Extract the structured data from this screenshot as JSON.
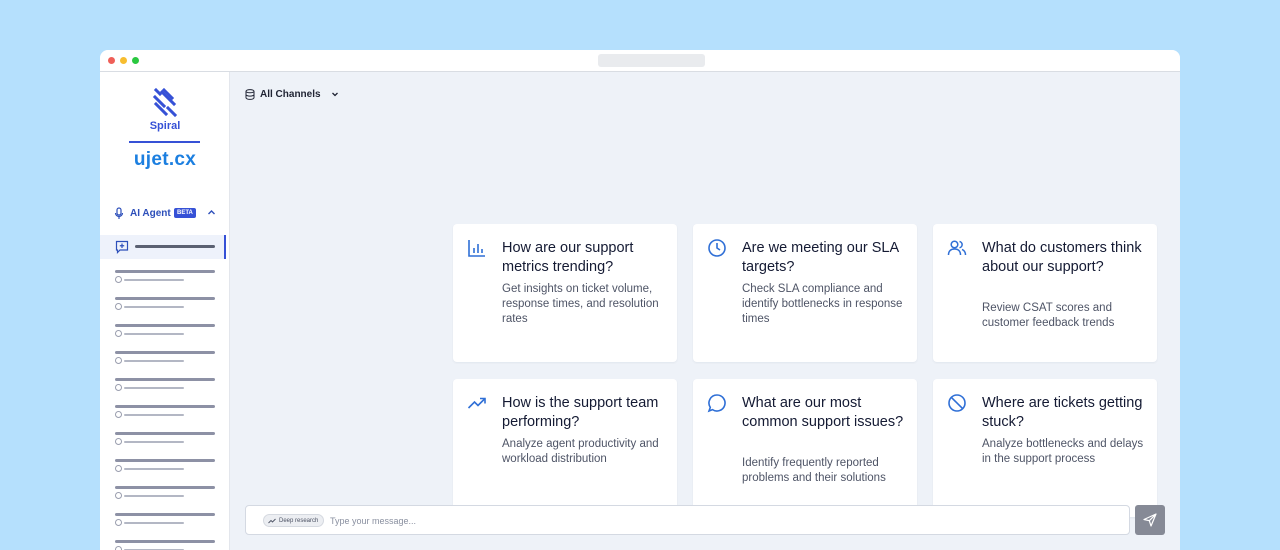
{
  "sidebar": {
    "logo_text": "Spiral",
    "brand": "ujet.cx",
    "agent_label": "AI Agent",
    "agent_badge": "BETA"
  },
  "header": {
    "channel_label": "All Channels"
  },
  "cards": [
    {
      "icon": "bar-chart-icon",
      "title": "How are our support metrics trending?",
      "desc": "Get insights on ticket volume, response times, and resolution rates"
    },
    {
      "icon": "clock-icon",
      "title": "Are we meeting our SLA targets?",
      "desc": "Check SLA compliance and identify bottlenecks in response  times"
    },
    {
      "icon": "users-icon",
      "title": "What do customers think about our support?",
      "desc": "Review CSAT scores and customer feedback trends"
    },
    {
      "icon": "trending-up-icon",
      "title": "How is the support team performing?",
      "desc": "Analyze agent productivity and workload distribution"
    },
    {
      "icon": "chat-bubble-icon",
      "title": "What are our most common support issues?",
      "desc": "Identify frequently reported problems and their solutions"
    },
    {
      "icon": "blocked-icon",
      "title": "Where are tickets getting stuck?",
      "desc": "Analyze bottlenecks and delays in the support process"
    }
  ],
  "composer": {
    "deep_research_label": "Deep research",
    "placeholder": "Type your message..."
  },
  "colors": {
    "accent": "#3651d6",
    "icon_blue": "#2f6fd6",
    "background": "#b5e0fd",
    "send_button": "#868a96"
  }
}
